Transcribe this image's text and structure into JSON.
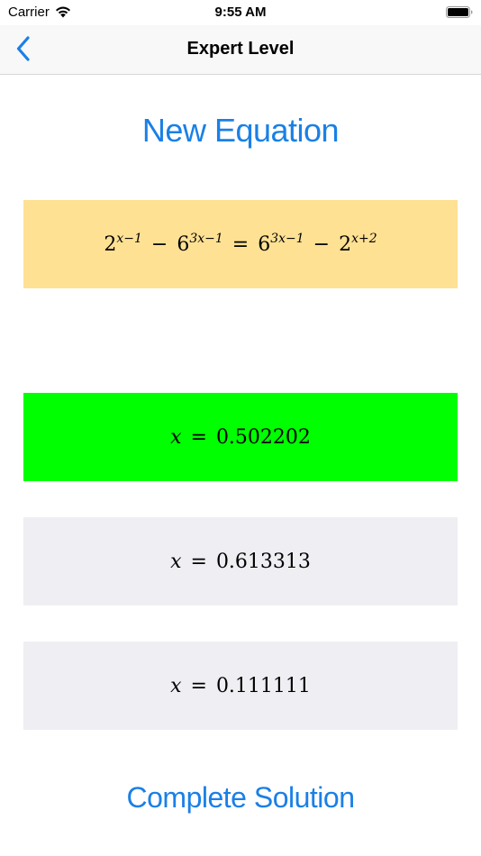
{
  "status_bar": {
    "carrier": "Carrier",
    "time": "9:55 AM"
  },
  "nav": {
    "back_icon": "chevron-left-icon",
    "title": "Expert Level"
  },
  "new_equation_label": "New Equation",
  "equation": {
    "base1": "2",
    "exp1": "x−1",
    "minus1": "−",
    "base2": "6",
    "exp2": "3x−1",
    "equals": "=",
    "base3": "6",
    "exp3": "3x−1",
    "minus2": "−",
    "base4": "2",
    "exp4": "x+2"
  },
  "answers": [
    {
      "var": "x",
      "eq": "=",
      "value": "0.502202",
      "color": "#00ff00"
    },
    {
      "var": "x",
      "eq": "=",
      "value": "0.613313",
      "color": "#efeff3"
    },
    {
      "var": "x",
      "eq": "=",
      "value": "0.111111",
      "color": "#efeff3"
    }
  ],
  "complete_solution_label": "Complete Solution",
  "colors": {
    "accent": "#1a80e6",
    "equation_bg": "#ffe194"
  }
}
